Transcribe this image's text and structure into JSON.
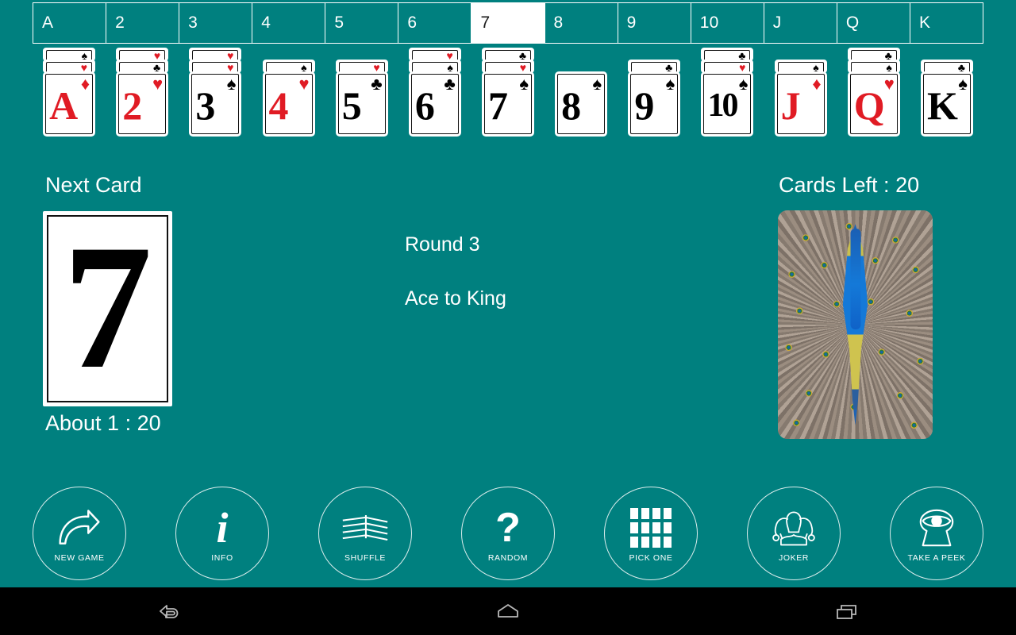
{
  "app": {
    "background_color": "#00807f",
    "accent_color": "#ffffff",
    "red_color": "#e01b24"
  },
  "rank_tabs": {
    "active_rank": "7",
    "items": [
      {
        "label": "A"
      },
      {
        "label": "2"
      },
      {
        "label": "3"
      },
      {
        "label": "4"
      },
      {
        "label": "5"
      },
      {
        "label": "6"
      },
      {
        "label": "7"
      },
      {
        "label": "8"
      },
      {
        "label": "9"
      },
      {
        "label": "10"
      },
      {
        "label": "J"
      },
      {
        "label": "Q"
      },
      {
        "label": "K"
      }
    ]
  },
  "card_columns": [
    {
      "rank": "A",
      "suit": "♦",
      "color": "red",
      "buried": [
        {
          "suit": "♠",
          "color": "black"
        },
        {
          "suit": "♥",
          "color": "red"
        }
      ]
    },
    {
      "rank": "2",
      "suit": "♥",
      "color": "red",
      "buried": [
        {
          "suit": "♥",
          "color": "red"
        },
        {
          "suit": "♣",
          "color": "black"
        }
      ]
    },
    {
      "rank": "3",
      "suit": "♠",
      "color": "black",
      "buried": [
        {
          "suit": "♥",
          "color": "red"
        },
        {
          "suit": "♥",
          "color": "red"
        }
      ]
    },
    {
      "rank": "4",
      "suit": "♥",
      "color": "red",
      "buried": [
        {
          "suit": "♠",
          "color": "black"
        }
      ]
    },
    {
      "rank": "5",
      "suit": "♣",
      "color": "black",
      "buried": [
        {
          "suit": "♥",
          "color": "red"
        }
      ]
    },
    {
      "rank": "6",
      "suit": "♣",
      "color": "black",
      "buried": [
        {
          "suit": "♥",
          "color": "red"
        },
        {
          "suit": "♠",
          "color": "black"
        }
      ]
    },
    {
      "rank": "7",
      "suit": "♠",
      "color": "black",
      "buried": [
        {
          "suit": "♣",
          "color": "black"
        },
        {
          "suit": "♥",
          "color": "red"
        }
      ]
    },
    {
      "rank": "8",
      "suit": "♠",
      "color": "black",
      "buried": []
    },
    {
      "rank": "9",
      "suit": "♠",
      "color": "black",
      "buried": [
        {
          "suit": "♣",
          "color": "black"
        }
      ]
    },
    {
      "rank": "10",
      "suit": "♠",
      "color": "black",
      "buried": [
        {
          "suit": "♣",
          "color": "black"
        },
        {
          "suit": "♥",
          "color": "red"
        }
      ]
    },
    {
      "rank": "J",
      "suit": "♦",
      "color": "red",
      "buried": [
        {
          "suit": "♠",
          "color": "black"
        }
      ]
    },
    {
      "rank": "Q",
      "suit": "♥",
      "color": "red",
      "buried": [
        {
          "suit": "♣",
          "color": "black"
        },
        {
          "suit": "♠",
          "color": "black"
        }
      ]
    },
    {
      "rank": "K",
      "suit": "♠",
      "color": "black",
      "buried": [
        {
          "suit": "♣",
          "color": "black"
        }
      ]
    }
  ],
  "next_card": {
    "label": "Next Card",
    "rank": "7",
    "odds_label": "About 1 :  20"
  },
  "status": {
    "round": "Round 3",
    "mode": "Ace to King",
    "cards_left": "Cards Left :  20"
  },
  "deck": {
    "name": "peacock-card-back"
  },
  "actions": [
    {
      "label": "NEW GAME",
      "icon": "curved-arrow-icon"
    },
    {
      "label": "INFO",
      "icon": "info-icon"
    },
    {
      "label": "SHUFFLE",
      "icon": "shuffle-cards-icon"
    },
    {
      "label": "RANDOM",
      "icon": "question-mark-icon"
    },
    {
      "label": "PICK ONE",
      "icon": "grid-icon"
    },
    {
      "label": "JOKER",
      "icon": "jester-hat-icon"
    },
    {
      "label": "TAKE A PEEK",
      "icon": "keyhole-eye-icon"
    }
  ],
  "navbar": {
    "back": "back-icon",
    "home": "home-icon",
    "recents": "recents-icon"
  }
}
